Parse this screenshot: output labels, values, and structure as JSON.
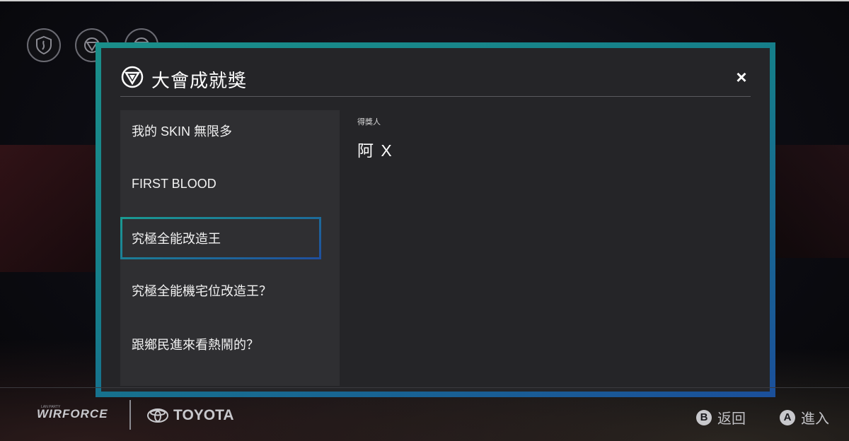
{
  "top_icons": [
    {
      "icon": "shield-icon"
    },
    {
      "icon": "triangle-badge-icon"
    },
    {
      "icon": "triangle-badge-icon"
    }
  ],
  "modal": {
    "title": "大會成就獎",
    "title_icon": "triangle-circle-icon",
    "close_label": "×"
  },
  "categories": [
    {
      "label": "我的 SKIN 無限多",
      "selected": false
    },
    {
      "label": "FIRST BLOOD",
      "selected": false
    },
    {
      "label": "究極全能改造王",
      "selected": true
    },
    {
      "label": "究極全能機宅位改造王？",
      "selected": false
    },
    {
      "label": "跟鄉民進來看熱鬧的？",
      "selected": false
    }
  ],
  "detail": {
    "winner_label": "得獎人",
    "winner_name": "阿 X"
  },
  "footer": {
    "brand_wirforce": "WIRFORCE",
    "brand_wirforce_small": "LAN PARTY",
    "brand_toyota": "TOYOTA",
    "hints": [
      {
        "key": "B",
        "label": "返回"
      },
      {
        "key": "A",
        "label": "進入"
      }
    ]
  },
  "colors": {
    "accent_teal": "#1a8f8a",
    "accent_blue": "#1b4f9a",
    "modal_bg": "#252528",
    "list_bg": "#2f2f32"
  }
}
